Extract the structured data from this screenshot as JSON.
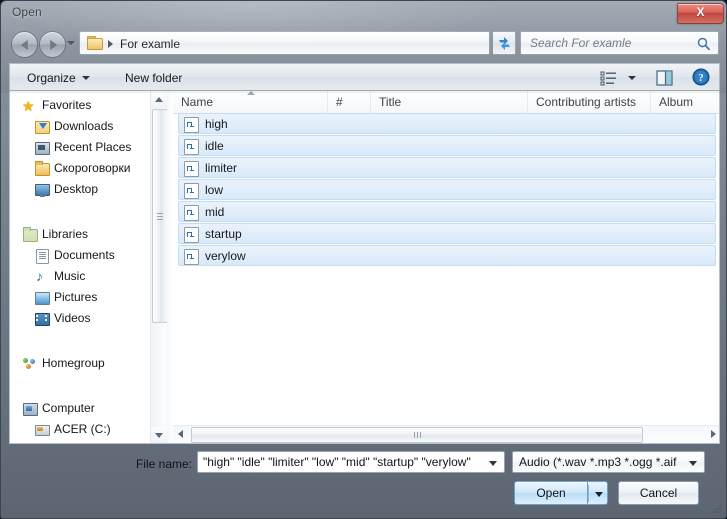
{
  "window": {
    "title": "Open",
    "close_label": "X"
  },
  "address": {
    "folder_icon": "folder-icon",
    "crumb": "For examle",
    "dropdown_icon": "chevron-down-icon",
    "refresh_icon": "refresh-icon"
  },
  "search": {
    "placeholder": "Search For examle",
    "icon": "search-icon"
  },
  "toolbar": {
    "organize": "Organize",
    "new_folder": "New folder",
    "views_icon": "list-view-icon",
    "preview_icon": "preview-pane-icon",
    "help_icon": "help-icon"
  },
  "sidebar": {
    "items": [
      {
        "label": "Favorites",
        "icon": "star-icon",
        "level": "header"
      },
      {
        "label": "Downloads",
        "icon": "downloads-folder-icon",
        "level": "child"
      },
      {
        "label": "Recent Places",
        "icon": "recent-places-icon",
        "level": "child"
      },
      {
        "label": "Скороговорки",
        "icon": "folder-icon",
        "level": "child"
      },
      {
        "label": "Desktop",
        "icon": "desktop-icon",
        "level": "child"
      },
      {
        "label": "Libraries",
        "icon": "libraries-icon",
        "level": "header"
      },
      {
        "label": "Documents",
        "icon": "documents-icon",
        "level": "child"
      },
      {
        "label": "Music",
        "icon": "music-icon",
        "level": "child"
      },
      {
        "label": "Pictures",
        "icon": "pictures-icon",
        "level": "child"
      },
      {
        "label": "Videos",
        "icon": "videos-icon",
        "level": "child"
      },
      {
        "label": "Homegroup",
        "icon": "homegroup-icon",
        "level": "header"
      },
      {
        "label": "Computer",
        "icon": "computer-icon",
        "level": "header"
      },
      {
        "label": "ACER (C:)",
        "icon": "drive-icon",
        "level": "child"
      }
    ]
  },
  "filelist": {
    "columns": [
      {
        "label": "Name",
        "sorted": "asc"
      },
      {
        "label": "#"
      },
      {
        "label": "Title"
      },
      {
        "label": "Contributing artists"
      },
      {
        "label": "Album"
      }
    ],
    "rows": [
      {
        "name": "high",
        "icon": "wave-file-icon",
        "selected": true
      },
      {
        "name": "idle",
        "icon": "wave-file-icon",
        "selected": true
      },
      {
        "name": "limiter",
        "icon": "wave-file-icon",
        "selected": true
      },
      {
        "name": "low",
        "icon": "wave-file-icon",
        "selected": true
      },
      {
        "name": "mid",
        "icon": "wave-file-icon",
        "selected": true
      },
      {
        "name": "startup",
        "icon": "wave-file-icon",
        "selected": true
      },
      {
        "name": "verylow",
        "icon": "wave-file-icon",
        "selected": true
      }
    ]
  },
  "footer": {
    "file_name_label": "File name:",
    "file_name_value": "\"high\" \"idle\" \"limiter\" \"low\" \"mid\" \"startup\" \"verylow\"",
    "file_type_value": "Audio (*.wav *.mp3 *.ogg *.aif",
    "open_label": "Open",
    "cancel_label": "Cancel"
  },
  "colors": {
    "selection": "#d9e9f9",
    "selection_border": "#c5ddf3",
    "close_button": "#d4453a",
    "default_button": "#cfe8fa"
  }
}
